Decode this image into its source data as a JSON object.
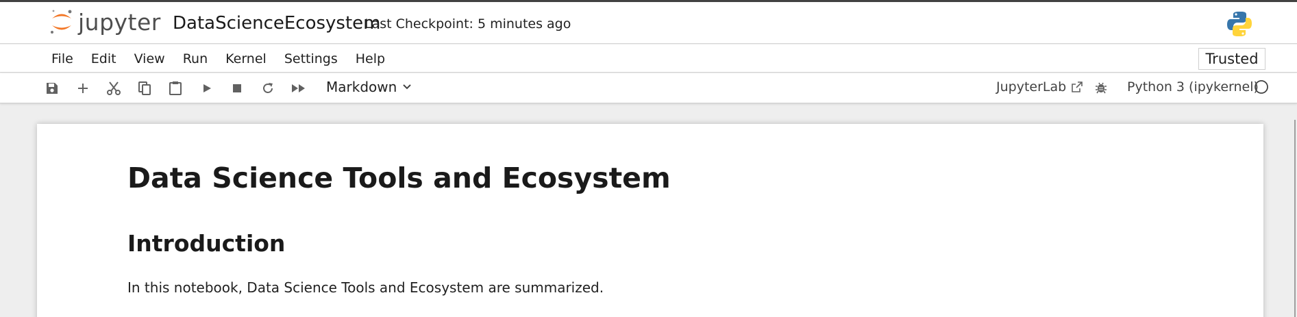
{
  "header": {
    "logo_text": "jupyter",
    "notebook_title": "DataScienceEcosystem",
    "checkpoint": "Last Checkpoint: 5 minutes ago"
  },
  "menubar": {
    "items": [
      "File",
      "Edit",
      "View",
      "Run",
      "Kernel",
      "Settings",
      "Help"
    ],
    "trusted": "Trusted"
  },
  "toolbar": {
    "buttons": [
      "save-icon",
      "add-cell-icon",
      "cut-icon",
      "copy-icon",
      "paste-icon",
      "run-icon",
      "stop-icon",
      "restart-icon",
      "fast-forward-icon"
    ],
    "cell_type": "Markdown",
    "jupyterlab_link": "JupyterLab",
    "kernel_name": "Python 3 (ipykernel)"
  },
  "notebook": {
    "heading1": "Data Science Tools and Ecosystem",
    "heading2": "Introduction",
    "paragraph": "In this notebook, Data Science Tools and Ecosystem are summarized."
  },
  "colors": {
    "jupyter_orange": "#F37726",
    "python_blue": "#3776AB",
    "python_yellow": "#FFD43B"
  }
}
